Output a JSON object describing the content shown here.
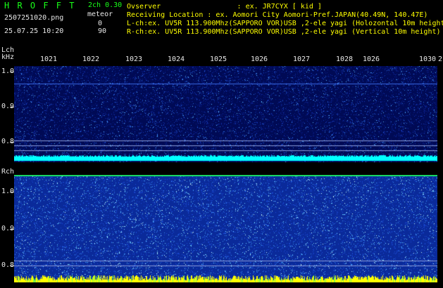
{
  "app": {
    "logo": "H R O F F T",
    "version": "2ch 0.30",
    "filename": "2507251020.png",
    "datetime": "25.07.25 10:20",
    "meteor_label": "meteor",
    "meteor_lch": "0",
    "meteor_rch": "90"
  },
  "header": {
    "line1": "Ovserver                  : ex. JR7CYX [ kid ]",
    "line2": "Receiving Location : ex. Aomori City Aomori-Pref.JAPAN(40.49N, 140.47E)",
    "line3": "L-ch:ex. UV5R 113.900Mhz(SAPPORO VOR)USB ,2-ele yagi (Holozontal 10m height",
    "line4": "R-ch:ex. UV5R 113.900Mhz(SAPPORO VOR)USB ,2-ele yagi (Vertical 10m height)"
  },
  "axis": {
    "lch_label": "Lch",
    "unit_label": "kHz",
    "rch_label": "Rch",
    "time_ticks": [
      "1021",
      "1022",
      "1023",
      "1024",
      "1025",
      "1026",
      "1027",
      "1028",
      "1026",
      "1030",
      "2"
    ],
    "lch_freq_ticks": [
      "1.0",
      "0.9",
      "0.8"
    ],
    "rch_freq_ticks": [
      "1.0",
      "0.9",
      "0.8"
    ]
  },
  "colors": {
    "logo_green": "#19ff19",
    "header_yellow": "#ffff00",
    "trace_cyan": "#00ffff",
    "meteor_yellow": "#ffff00",
    "bg_blue_dark": "#000a55",
    "bg_blue_light": "#0a2a9a"
  }
}
